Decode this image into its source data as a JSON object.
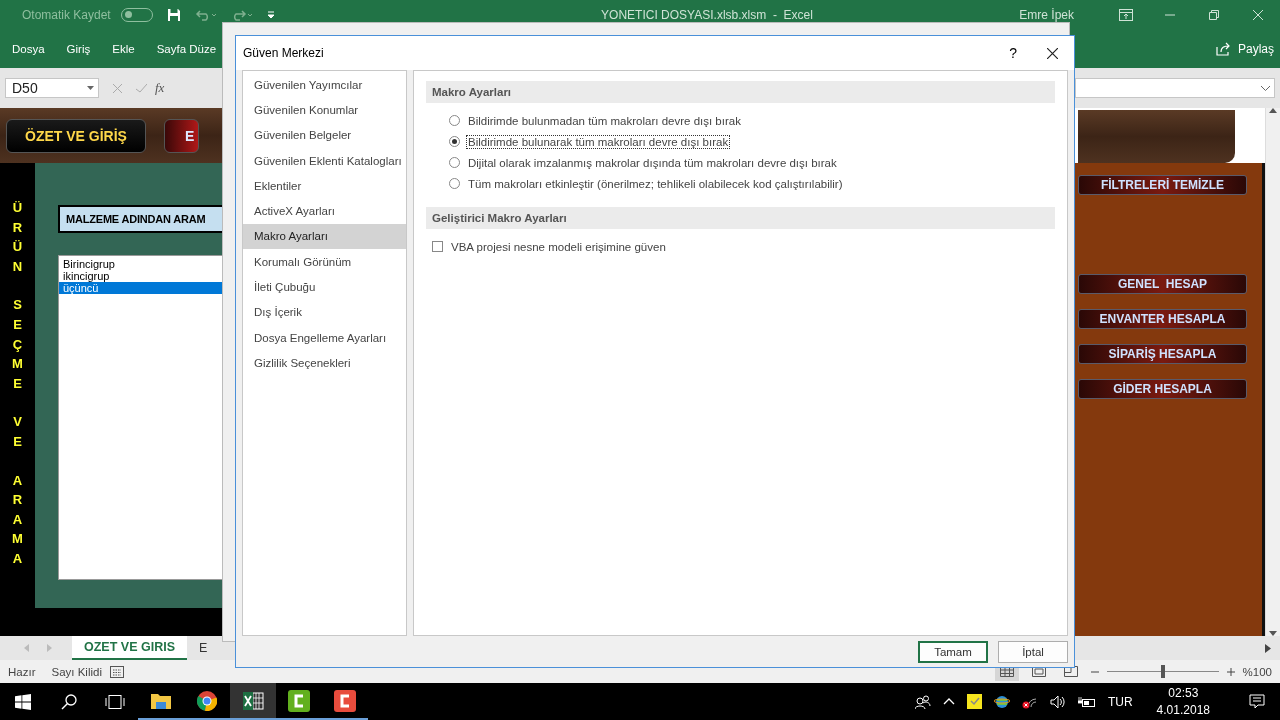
{
  "title_bar": {
    "autosave_label": "Otomatik Kaydet",
    "autosave_on": false,
    "title": "YONETICI DOSYASI.xlsb.xlsm  -  Excel",
    "user": "Emre İpek"
  },
  "ribbon_tabs": [
    {
      "label": "Dosya"
    },
    {
      "label": "Giriş"
    },
    {
      "label": "Ekle"
    },
    {
      "label": "Sayfa Düze"
    }
  ],
  "share_label": "Paylaş",
  "formula_bar": {
    "name_box": "D50",
    "function_label": "fx"
  },
  "sheet": {
    "header_buttons": [
      "ÖZET VE GİRİŞ",
      "E"
    ],
    "vertical_words": [
      "ÜRÜN",
      "SEÇME",
      "VE",
      "ARAMA"
    ],
    "search_label": "MALZEME ADINDAN ARAM",
    "list": [
      {
        "label": "Birincigrup",
        "selected": false
      },
      {
        "label": "ikincigrup",
        "selected": false
      },
      {
        "label": "üçüncü",
        "selected": true
      }
    ],
    "action_buttons": [
      "FİLTRELERİ TEMİZLE",
      "GENEL  HESAP",
      "ENVANTER HESAPLA",
      "SİPARİŞ HESAPLA",
      "GİDER HESAPLA"
    ]
  },
  "sheet_tabs": [
    {
      "label": "OZET VE GIRIS",
      "selected": true
    },
    {
      "label": "E",
      "selected": false
    }
  ],
  "status_bar": {
    "items": [
      "Hazır",
      "Sayı Kilidi"
    ],
    "zoom": {
      "level": 0.5,
      "reading": "%100"
    }
  },
  "dialog": {
    "title": "Güven Merkezi",
    "help": "?",
    "nav": [
      {
        "label": "Güvenilen Yayımcılar",
        "selected": false
      },
      {
        "label": "Güvenilen Konumlar",
        "selected": false
      },
      {
        "label": "Güvenilen Belgeler",
        "selected": false
      },
      {
        "label": "Güvenilen Eklenti Katalogları",
        "selected": false
      },
      {
        "label": "Eklentiler",
        "selected": false
      },
      {
        "label": "ActiveX Ayarları",
        "selected": false
      },
      {
        "label": "Makro Ayarları",
        "selected": true
      },
      {
        "label": "Korumalı Görünüm",
        "selected": false
      },
      {
        "label": "İleti Çubuğu",
        "selected": false
      },
      {
        "label": "Dış İçerik",
        "selected": false
      },
      {
        "label": "Dosya Engelleme Ayarları",
        "selected": false
      },
      {
        "label": "Gizlilik Seçenekleri",
        "selected": false
      }
    ],
    "sections": [
      {
        "title": "Makro Ayarları",
        "options": [
          {
            "kind": "radio",
            "label": "Bildirimde bulunmadan tüm makroları devre dışı bırak",
            "selected": false
          },
          {
            "kind": "radio",
            "label": "Bildirimde bulunarak tüm makroları devre dışı bırak",
            "selected": true
          },
          {
            "kind": "radio",
            "label": "Dijital olarak imzalanmış makrolar dışında tüm makroları devre dışı bırak",
            "selected": false
          },
          {
            "kind": "radio",
            "label": "Tüm makroları etkinleştir (önerilmez; tehlikeli olabilecek kod çalıştırılabilir)",
            "selected": false
          }
        ]
      },
      {
        "title": "Geliştirici Makro Ayarları",
        "options": [
          {
            "kind": "checkbox",
            "label": "VBA projesi nesne modeli erişimine güven",
            "checked": false
          }
        ]
      }
    ],
    "buttons": [
      {
        "label": "Tamam",
        "default": true
      },
      {
        "label": "İptal",
        "default": false
      }
    ]
  },
  "taskbar": {
    "apps": [
      {
        "kind": "explorer",
        "active": false
      },
      {
        "kind": "chrome",
        "active": false
      },
      {
        "kind": "excel",
        "active": true
      },
      {
        "kind": "camtasia-green",
        "active": false
      },
      {
        "kind": "camtasia-red",
        "active": false
      }
    ],
    "language": "TUR",
    "time": "02:53",
    "date": "4.01.2018"
  }
}
